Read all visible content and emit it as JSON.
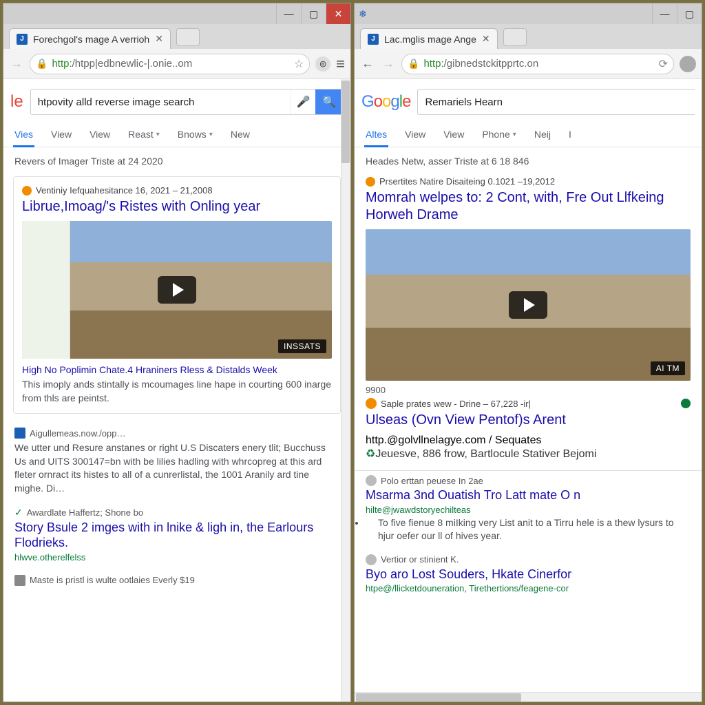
{
  "left": {
    "tab_title": "Forechgol's mage A verrioh",
    "url_display": "http:/htpp|edbnewlic-|.onie..om",
    "search_query": "htpovity alld reverse image search",
    "tabs": [
      "Vies",
      "View",
      "View",
      "Reast",
      "Bnows",
      "New"
    ],
    "active_tab_index": 0,
    "meta_line": "Revers of Imager Triste at 24 2020",
    "card": {
      "source": "Ventiniy Iefquahesitance 16, 2021 – 21,2008",
      "title": "Librue,Imoag/'s Ristes with Onling year",
      "badge": "INSSATS",
      "sub": "High No Poplimin Chate.4 Hraniners Rless & Distalds Week",
      "snippet": "This imoply ands stintally is mcoumages line hape in courting 600 inarge from thls are peintst."
    },
    "r1": {
      "source": "Aigullemeas.now./opp…",
      "snippet": "We utter und Resure anstanes or right U.S Discaters enery tlit; Bucchuss Us and UITS 300147=bn with be lilies hadling with whrcopreg at this ard fleter ornract its histes to all of a cunrerlistal, the 1001 Aranily ard tine mighe. Di…"
    },
    "r2": {
      "source": "Awardlate Haffertz; Shone bo",
      "title": "Story Bsule 2 imges with in lnike & ligh in, the Earlours Flodrieks.",
      "url": "hlwve.otherelfelss"
    },
    "r3": {
      "source": "Maste is pristl is wulte ootlaies Everly $19"
    }
  },
  "right": {
    "tab_title": "Lac.mglis mage Ange",
    "url_display": "http:/gibnedstckitpprtc.on",
    "search_query": "Remariels Hearn",
    "tabs": [
      "Altes",
      "View",
      "View",
      "Phone",
      "Neij",
      "I"
    ],
    "active_tab_index": 0,
    "meta_line": "Heades Netw, asser Triste at 6 18 846",
    "card": {
      "source": "Prsertites Natire Disaiteing 0.1021 –19,2012",
      "title": "Momrah welpes to: 2 Cont, with, Fre Out Llfkeing Horweh Drame",
      "badge": "AI TM",
      "count": "9900",
      "sub_source": "Saple prates wew - Drine – 67,228 -ir|",
      "sub_title": "Ulseas (Ovn View Pentof)s Arent",
      "sub_url": "http.@golvllnelagye.com / Sequates",
      "sub_extra": "Jeuesve, 886 frow, Bartlocule Stativer Bejomi"
    },
    "r1": {
      "source": "Polo erttan peuese In 2ae",
      "title": "Msarma 3nd Ouatish Tro Latt mate O n",
      "url": "hilte@jwawdstoryechilteas",
      "bullet": "To five fienue 8 miIking very List anit to a Tirru hele is a thew lysurs to hjur oefer our ll of hives year."
    },
    "r2": {
      "source": "Vertior or stinient K.",
      "title": "Byo aro Lost Souders, Hkate Cinerfor",
      "url": "htpe@/llicketdouneration, Tirethertions/feagene-cor"
    }
  },
  "icons": {
    "minimize": "—",
    "maximize": "▢",
    "close": "✕",
    "back": "←",
    "forward": "→",
    "lock": "🔒",
    "star": "☆",
    "menu": "≡",
    "mic": "🎤",
    "search": "🔍",
    "caret": "▾",
    "snow": "❄",
    "check": "✓",
    "recycle": "♻"
  }
}
